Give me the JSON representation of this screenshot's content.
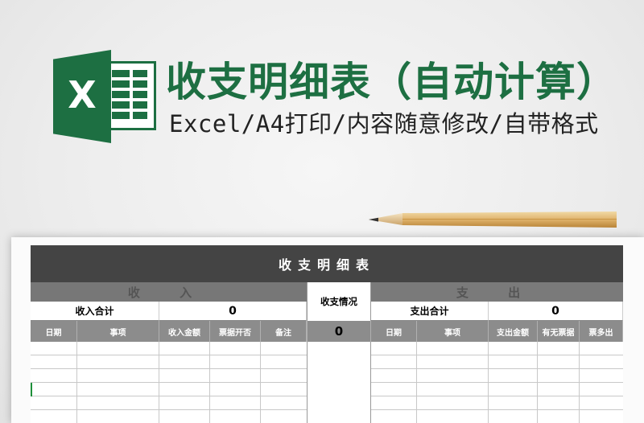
{
  "banner": {
    "logo_letter": "X",
    "title": "收支明细表（自动计算）",
    "subtitle": "Excel/A4打印/内容随意修改/自带格式"
  },
  "colors": {
    "brand_green": "#1d6f42",
    "header_dark": "#444444",
    "column_gray": "#8c8c8c"
  },
  "sheet": {
    "title": "收支明细表",
    "income": {
      "section_label": "收 入",
      "total_label": "收入合计",
      "total_value": "0",
      "columns": [
        "日期",
        "事项",
        "收入金额",
        "票据开否",
        "备注"
      ]
    },
    "center": {
      "label": "收支情况",
      "value": "0"
    },
    "expense": {
      "section_label": "支 出",
      "total_label": "支出合计",
      "total_value": "0",
      "columns": [
        "日期",
        "事项",
        "支出金额",
        "有无票据",
        "票多出"
      ]
    }
  }
}
